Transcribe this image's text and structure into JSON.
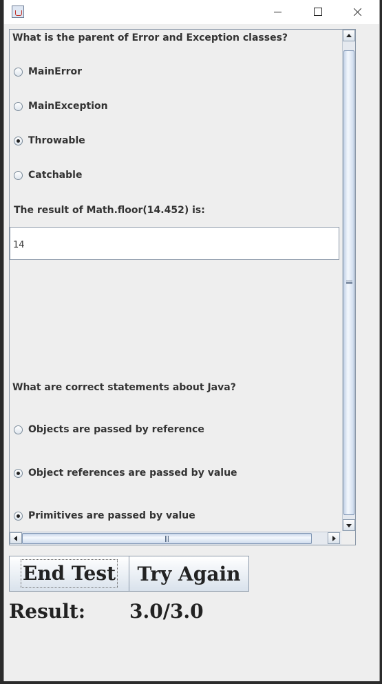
{
  "window": {
    "icon": "java-cup-icon"
  },
  "quiz": {
    "question1": {
      "text": "What is the parent of Error and Exception classes?",
      "options": [
        {
          "label": "MainError",
          "selected": false
        },
        {
          "label": "MainException",
          "selected": false
        },
        {
          "label": "Throwable",
          "selected": true
        },
        {
          "label": "Catchable",
          "selected": false
        }
      ]
    },
    "question2": {
      "text": "The result of Math.floor(14.452) is:",
      "answer": "14"
    },
    "question3": {
      "text": "What are correct statements about Java?",
      "options": [
        {
          "label": "Objects are passed by reference",
          "selected": false
        },
        {
          "label": "Object references are passed by value",
          "selected": true
        },
        {
          "label": "Primitives are passed by value",
          "selected": true
        }
      ]
    }
  },
  "buttons": {
    "end_test": "End Test",
    "try_again": "Try Again"
  },
  "result": {
    "label": "Result:",
    "value": "3.0/3.0"
  }
}
